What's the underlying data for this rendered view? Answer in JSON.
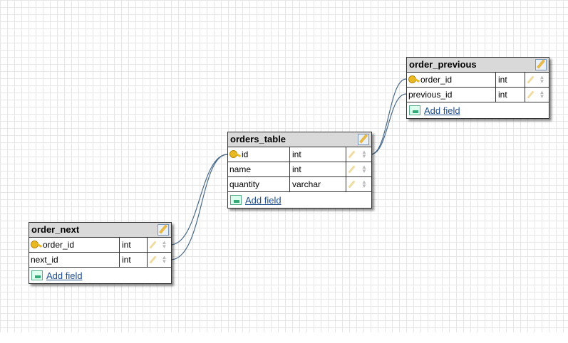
{
  "tables": [
    {
      "name": "order_previous",
      "fields": [
        {
          "name": "order_id",
          "type": "int",
          "pk": true
        },
        {
          "name": "previous_id",
          "type": "int",
          "pk": false
        }
      ],
      "add_label": "Add field"
    },
    {
      "name": "orders_table",
      "fields": [
        {
          "name": "id",
          "type": "int",
          "pk": true
        },
        {
          "name": "name",
          "type": "int",
          "pk": false
        },
        {
          "name": "quantity",
          "type": "varchar",
          "pk": false
        }
      ],
      "add_label": "Add field"
    },
    {
      "name": "order_next",
      "fields": [
        {
          "name": "order_id",
          "type": "int",
          "pk": true
        },
        {
          "name": "next_id",
          "type": "int",
          "pk": false
        }
      ],
      "add_label": "Add field"
    }
  ],
  "relations": [
    {
      "from": "orders_table.id",
      "to": "order_previous.order_id"
    },
    {
      "from": "orders_table.id",
      "to": "order_previous.previous_id"
    },
    {
      "from": "orders_table.id",
      "to": "order_next.order_id"
    },
    {
      "from": "orders_table.id",
      "to": "order_next.next_id"
    }
  ]
}
